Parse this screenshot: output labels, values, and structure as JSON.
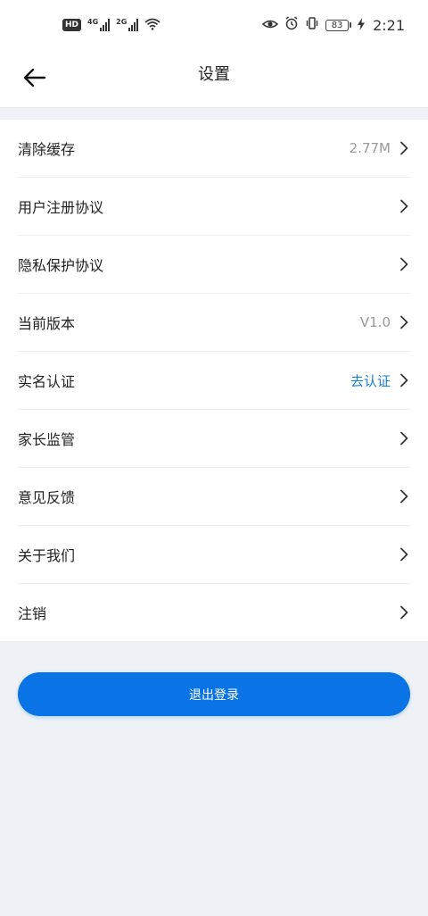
{
  "status_bar": {
    "hd": "HD",
    "net1": "4G",
    "net2": "2G",
    "battery": "83",
    "time": "2:21"
  },
  "header": {
    "title": "设置"
  },
  "settings": {
    "items": [
      {
        "name": "clear-cache",
        "label": "清除缓存",
        "value": "2.77M",
        "value_style": "muted"
      },
      {
        "name": "user-agreement",
        "label": "用户注册协议",
        "value": "",
        "value_style": "muted"
      },
      {
        "name": "privacy-policy",
        "label": "隐私保护协议",
        "value": "",
        "value_style": "muted"
      },
      {
        "name": "current-version",
        "label": "当前版本",
        "value": "V1.0",
        "value_style": "muted"
      },
      {
        "name": "real-name-auth",
        "label": "实名认证",
        "value": "去认证",
        "value_style": "link"
      },
      {
        "name": "parental-control",
        "label": "家长监管",
        "value": "",
        "value_style": "muted"
      },
      {
        "name": "feedback",
        "label": "意见反馈",
        "value": "",
        "value_style": "muted"
      },
      {
        "name": "about-us",
        "label": "关于我们",
        "value": "",
        "value_style": "muted"
      },
      {
        "name": "deactivate",
        "label": "注销",
        "value": "",
        "value_style": "muted"
      }
    ]
  },
  "logout": {
    "label": "退出登录"
  },
  "colors": {
    "accent": "#0a73e5",
    "link": "#1a7fd4",
    "muted": "#999999",
    "page_bg": "#eef2f6"
  }
}
